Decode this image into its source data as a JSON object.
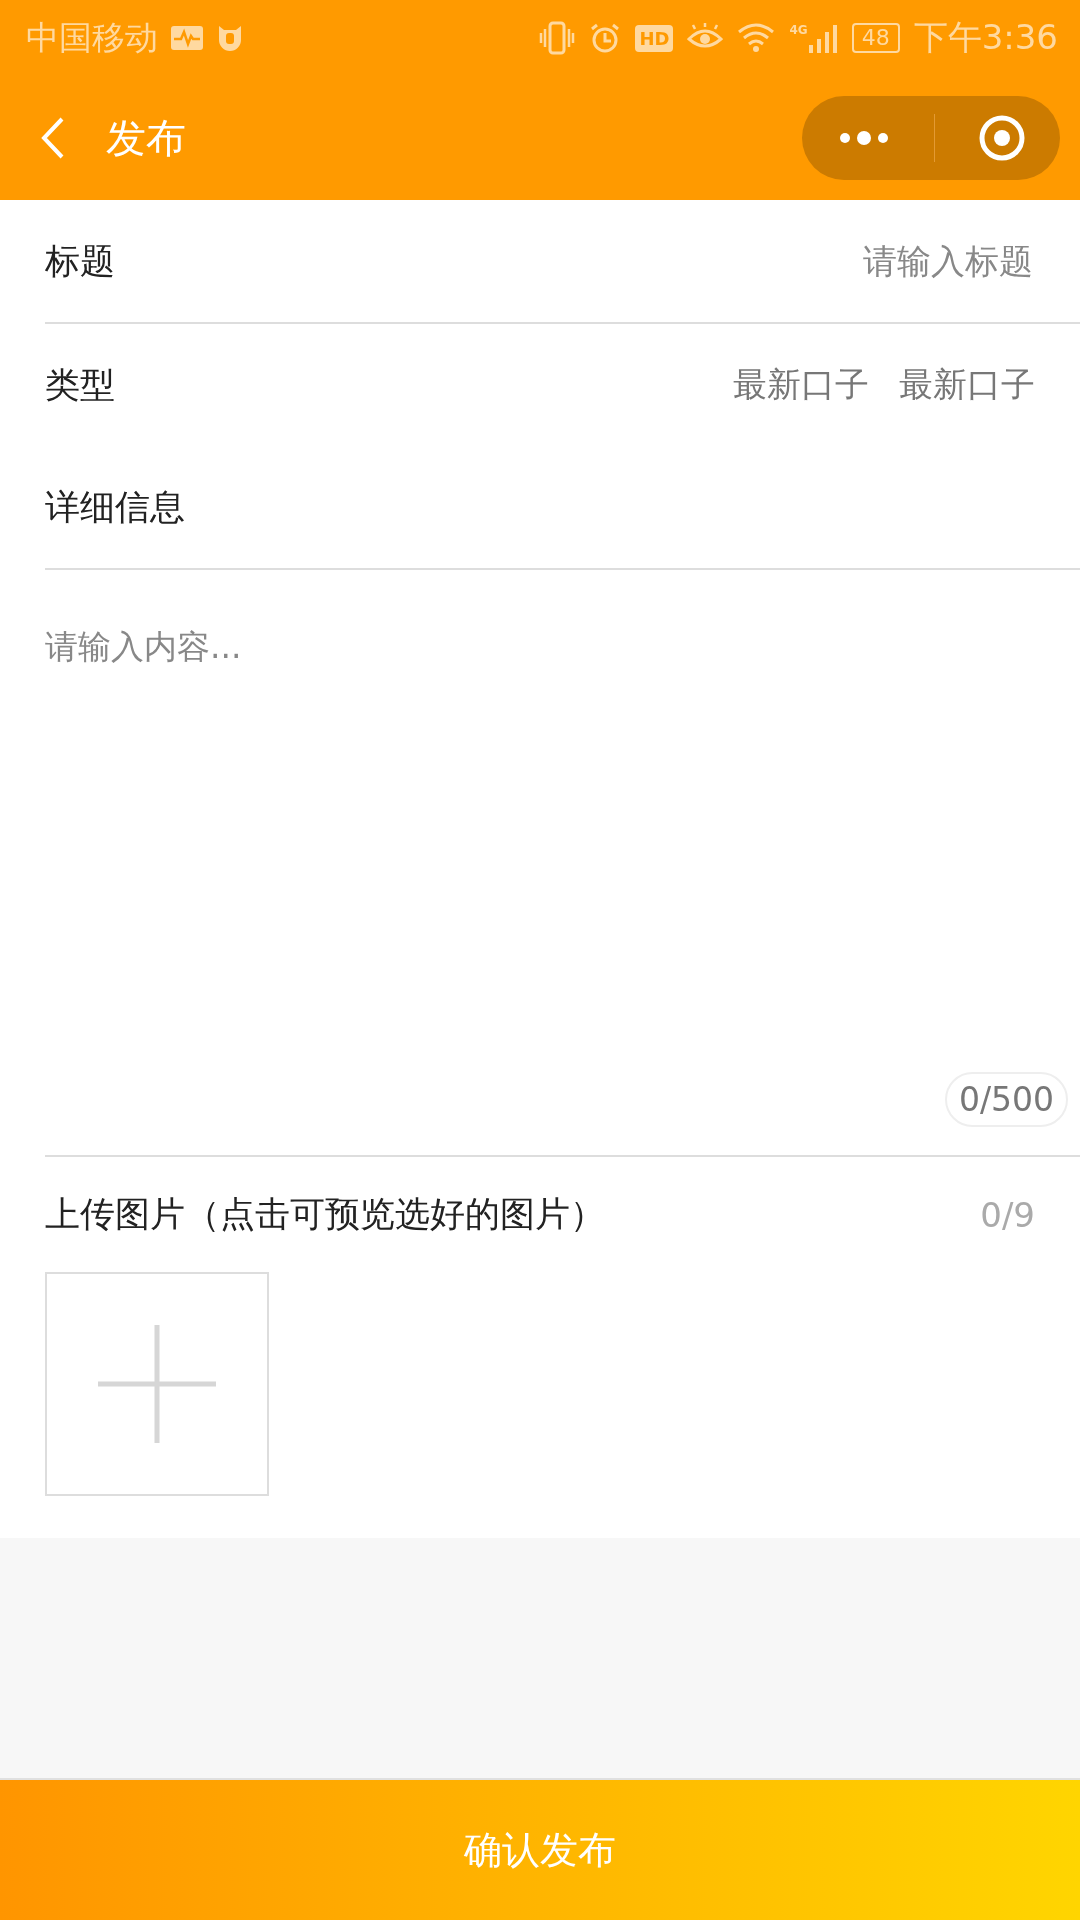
{
  "status_bar": {
    "carrier": "中国移动",
    "hd": "HD",
    "network": "4G",
    "battery": "48",
    "time": "下午3:36"
  },
  "header": {
    "title": "发布"
  },
  "form": {
    "title_field": {
      "label": "标题",
      "placeholder": "请输入标题"
    },
    "type_field": {
      "label": "类型",
      "options": [
        "最新口子",
        "最新口子"
      ]
    },
    "detail": {
      "label": "详细信息",
      "placeholder": "请输入内容...",
      "counter": "0/500"
    },
    "upload": {
      "label": "上传图片（点击可预览选好的图片）",
      "count": "0/9"
    }
  },
  "submit_button": "确认发布"
}
